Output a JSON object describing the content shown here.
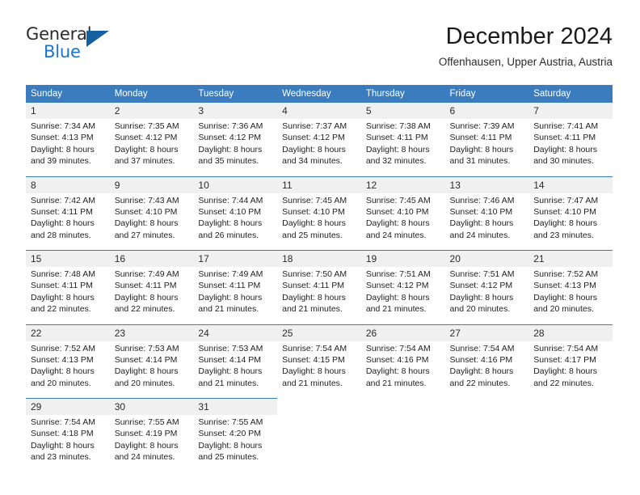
{
  "brand": {
    "name_part1": "General",
    "name_part2": "Blue",
    "triangle_color": "#15619f",
    "blue": "#1b76c4"
  },
  "header": {
    "title": "December 2024",
    "location": "Offenhausen, Upper Austria, Austria"
  },
  "theme": {
    "header_bg": "#3a7cbe",
    "header_text": "#ffffff",
    "daynum_bg": "#f0f0f0",
    "cell_bg": "#ffffff",
    "row_border": "#3a7cbe"
  },
  "weekdays": [
    "Sunday",
    "Monday",
    "Tuesday",
    "Wednesday",
    "Thursday",
    "Friday",
    "Saturday"
  ],
  "weeks": [
    {
      "days": [
        {
          "num": "1",
          "sunrise": "Sunrise: 7:34 AM",
          "sunset": "Sunset: 4:13 PM",
          "daylight1": "Daylight: 8 hours",
          "daylight2": "and 39 minutes."
        },
        {
          "num": "2",
          "sunrise": "Sunrise: 7:35 AM",
          "sunset": "Sunset: 4:12 PM",
          "daylight1": "Daylight: 8 hours",
          "daylight2": "and 37 minutes."
        },
        {
          "num": "3",
          "sunrise": "Sunrise: 7:36 AM",
          "sunset": "Sunset: 4:12 PM",
          "daylight1": "Daylight: 8 hours",
          "daylight2": "and 35 minutes."
        },
        {
          "num": "4",
          "sunrise": "Sunrise: 7:37 AM",
          "sunset": "Sunset: 4:12 PM",
          "daylight1": "Daylight: 8 hours",
          "daylight2": "and 34 minutes."
        },
        {
          "num": "5",
          "sunrise": "Sunrise: 7:38 AM",
          "sunset": "Sunset: 4:11 PM",
          "daylight1": "Daylight: 8 hours",
          "daylight2": "and 32 minutes."
        },
        {
          "num": "6",
          "sunrise": "Sunrise: 7:39 AM",
          "sunset": "Sunset: 4:11 PM",
          "daylight1": "Daylight: 8 hours",
          "daylight2": "and 31 minutes."
        },
        {
          "num": "7",
          "sunrise": "Sunrise: 7:41 AM",
          "sunset": "Sunset: 4:11 PM",
          "daylight1": "Daylight: 8 hours",
          "daylight2": "and 30 minutes."
        }
      ]
    },
    {
      "days": [
        {
          "num": "8",
          "sunrise": "Sunrise: 7:42 AM",
          "sunset": "Sunset: 4:11 PM",
          "daylight1": "Daylight: 8 hours",
          "daylight2": "and 28 minutes."
        },
        {
          "num": "9",
          "sunrise": "Sunrise: 7:43 AM",
          "sunset": "Sunset: 4:10 PM",
          "daylight1": "Daylight: 8 hours",
          "daylight2": "and 27 minutes."
        },
        {
          "num": "10",
          "sunrise": "Sunrise: 7:44 AM",
          "sunset": "Sunset: 4:10 PM",
          "daylight1": "Daylight: 8 hours",
          "daylight2": "and 26 minutes."
        },
        {
          "num": "11",
          "sunrise": "Sunrise: 7:45 AM",
          "sunset": "Sunset: 4:10 PM",
          "daylight1": "Daylight: 8 hours",
          "daylight2": "and 25 minutes."
        },
        {
          "num": "12",
          "sunrise": "Sunrise: 7:45 AM",
          "sunset": "Sunset: 4:10 PM",
          "daylight1": "Daylight: 8 hours",
          "daylight2": "and 24 minutes."
        },
        {
          "num": "13",
          "sunrise": "Sunrise: 7:46 AM",
          "sunset": "Sunset: 4:10 PM",
          "daylight1": "Daylight: 8 hours",
          "daylight2": "and 24 minutes."
        },
        {
          "num": "14",
          "sunrise": "Sunrise: 7:47 AM",
          "sunset": "Sunset: 4:10 PM",
          "daylight1": "Daylight: 8 hours",
          "daylight2": "and 23 minutes."
        }
      ]
    },
    {
      "days": [
        {
          "num": "15",
          "sunrise": "Sunrise: 7:48 AM",
          "sunset": "Sunset: 4:11 PM",
          "daylight1": "Daylight: 8 hours",
          "daylight2": "and 22 minutes."
        },
        {
          "num": "16",
          "sunrise": "Sunrise: 7:49 AM",
          "sunset": "Sunset: 4:11 PM",
          "daylight1": "Daylight: 8 hours",
          "daylight2": "and 22 minutes."
        },
        {
          "num": "17",
          "sunrise": "Sunrise: 7:49 AM",
          "sunset": "Sunset: 4:11 PM",
          "daylight1": "Daylight: 8 hours",
          "daylight2": "and 21 minutes."
        },
        {
          "num": "18",
          "sunrise": "Sunrise: 7:50 AM",
          "sunset": "Sunset: 4:11 PM",
          "daylight1": "Daylight: 8 hours",
          "daylight2": "and 21 minutes."
        },
        {
          "num": "19",
          "sunrise": "Sunrise: 7:51 AM",
          "sunset": "Sunset: 4:12 PM",
          "daylight1": "Daylight: 8 hours",
          "daylight2": "and 21 minutes."
        },
        {
          "num": "20",
          "sunrise": "Sunrise: 7:51 AM",
          "sunset": "Sunset: 4:12 PM",
          "daylight1": "Daylight: 8 hours",
          "daylight2": "and 20 minutes."
        },
        {
          "num": "21",
          "sunrise": "Sunrise: 7:52 AM",
          "sunset": "Sunset: 4:13 PM",
          "daylight1": "Daylight: 8 hours",
          "daylight2": "and 20 minutes."
        }
      ]
    },
    {
      "days": [
        {
          "num": "22",
          "sunrise": "Sunrise: 7:52 AM",
          "sunset": "Sunset: 4:13 PM",
          "daylight1": "Daylight: 8 hours",
          "daylight2": "and 20 minutes."
        },
        {
          "num": "23",
          "sunrise": "Sunrise: 7:53 AM",
          "sunset": "Sunset: 4:14 PM",
          "daylight1": "Daylight: 8 hours",
          "daylight2": "and 20 minutes."
        },
        {
          "num": "24",
          "sunrise": "Sunrise: 7:53 AM",
          "sunset": "Sunset: 4:14 PM",
          "daylight1": "Daylight: 8 hours",
          "daylight2": "and 21 minutes."
        },
        {
          "num": "25",
          "sunrise": "Sunrise: 7:54 AM",
          "sunset": "Sunset: 4:15 PM",
          "daylight1": "Daylight: 8 hours",
          "daylight2": "and 21 minutes."
        },
        {
          "num": "26",
          "sunrise": "Sunrise: 7:54 AM",
          "sunset": "Sunset: 4:16 PM",
          "daylight1": "Daylight: 8 hours",
          "daylight2": "and 21 minutes."
        },
        {
          "num": "27",
          "sunrise": "Sunrise: 7:54 AM",
          "sunset": "Sunset: 4:16 PM",
          "daylight1": "Daylight: 8 hours",
          "daylight2": "and 22 minutes."
        },
        {
          "num": "28",
          "sunrise": "Sunrise: 7:54 AM",
          "sunset": "Sunset: 4:17 PM",
          "daylight1": "Daylight: 8 hours",
          "daylight2": "and 22 minutes."
        }
      ]
    },
    {
      "days": [
        {
          "num": "29",
          "sunrise": "Sunrise: 7:54 AM",
          "sunset": "Sunset: 4:18 PM",
          "daylight1": "Daylight: 8 hours",
          "daylight2": "and 23 minutes."
        },
        {
          "num": "30",
          "sunrise": "Sunrise: 7:55 AM",
          "sunset": "Sunset: 4:19 PM",
          "daylight1": "Daylight: 8 hours",
          "daylight2": "and 24 minutes."
        },
        {
          "num": "31",
          "sunrise": "Sunrise: 7:55 AM",
          "sunset": "Sunset: 4:20 PM",
          "daylight1": "Daylight: 8 hours",
          "daylight2": "and 25 minutes."
        },
        {
          "num": "",
          "sunrise": "",
          "sunset": "",
          "daylight1": "",
          "daylight2": ""
        },
        {
          "num": "",
          "sunrise": "",
          "sunset": "",
          "daylight1": "",
          "daylight2": ""
        },
        {
          "num": "",
          "sunrise": "",
          "sunset": "",
          "daylight1": "",
          "daylight2": ""
        },
        {
          "num": "",
          "sunrise": "",
          "sunset": "",
          "daylight1": "",
          "daylight2": ""
        }
      ]
    }
  ]
}
